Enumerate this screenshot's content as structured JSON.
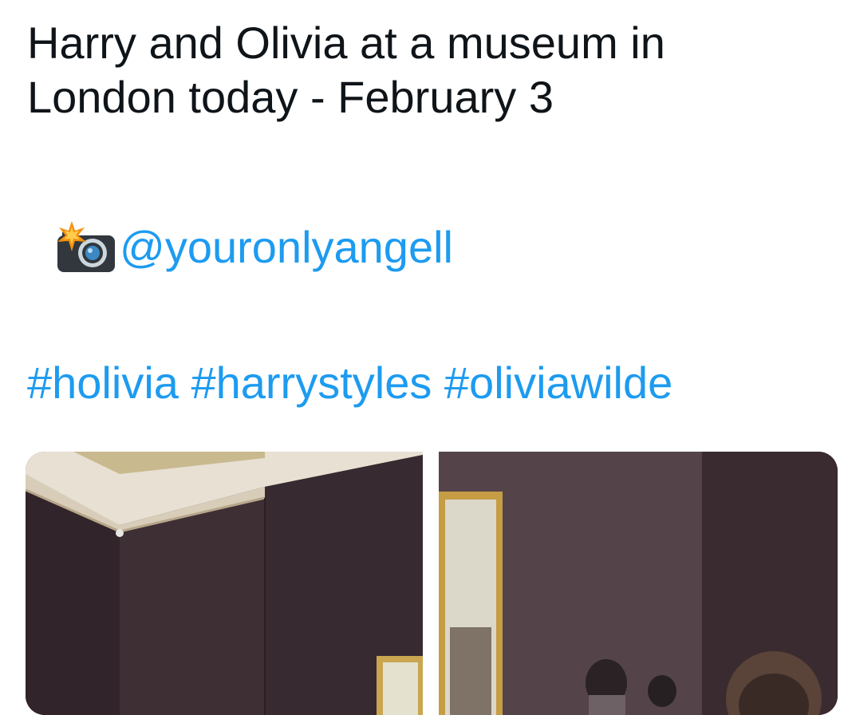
{
  "tweet": {
    "text_line_1": "Harry and Olivia at a museum in",
    "text_line_2": "London today - February 3",
    "credit": {
      "icon": "camera-with-flash-icon",
      "mention": "@youronlyangell"
    },
    "hashtags": [
      "#holivia",
      "#harrystyles",
      "#oliviawilde"
    ]
  },
  "media": {
    "photos": [
      {
        "name": "museum-gallery-corner-photo"
      },
      {
        "name": "museum-gallery-visitors-photo"
      }
    ]
  },
  "colors": {
    "text": "#0f1419",
    "link": "#1d9bf0"
  }
}
